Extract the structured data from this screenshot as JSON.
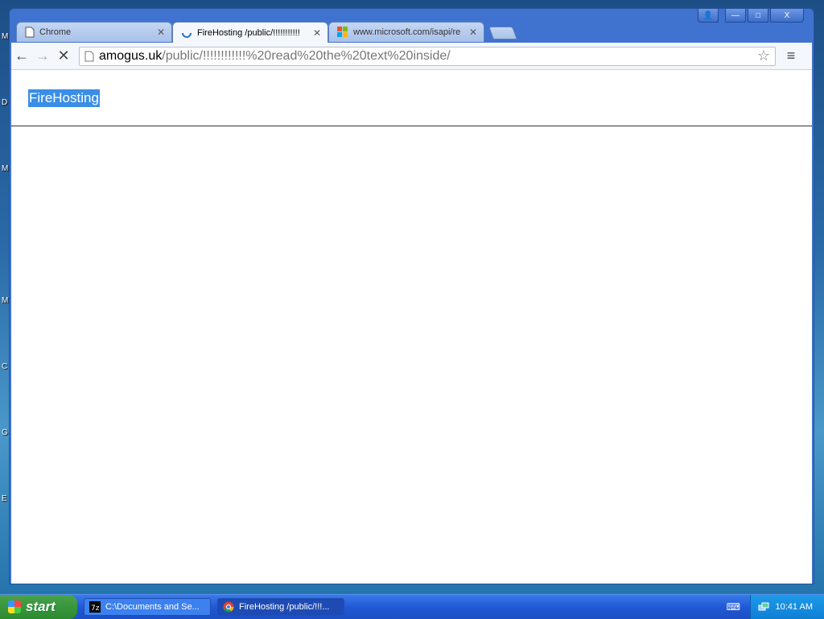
{
  "desktop": {
    "letters": [
      "M",
      "D",
      "M",
      "M",
      "C",
      "G",
      "E"
    ]
  },
  "window": {
    "controls": {
      "profile": "👤",
      "minimize": "—",
      "maximize": "□",
      "close": "X"
    }
  },
  "tabs": [
    {
      "title": "Chrome",
      "close": "✕"
    },
    {
      "title": "FireHosting /public/!!!!!!!!!!!",
      "close": "✕"
    },
    {
      "title": "www.microsoft.com/isapi/re",
      "close": "✕"
    }
  ],
  "toolbar": {
    "back": "←",
    "forward": "→",
    "stop": "✕",
    "url_host": "amogus.uk",
    "url_path": "/public/!!!!!!!!!!!!%20read%20the%20text%20inside/",
    "star": "☆",
    "menu": "≡"
  },
  "page": {
    "site_title": "FireHosting"
  },
  "taskbar": {
    "start": "start",
    "tasks": [
      {
        "label": "C:\\Documents and Se..."
      },
      {
        "label": "FireHosting /public/!!!..."
      }
    ],
    "clock": "10:41 AM"
  }
}
